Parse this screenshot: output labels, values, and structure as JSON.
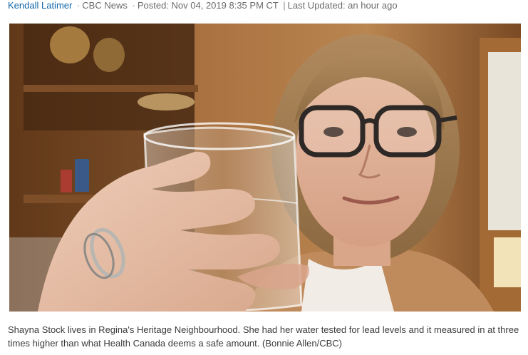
{
  "byline": {
    "author": "Kendall Latimer",
    "bullet": "·",
    "outlet": "CBC News",
    "posted": "Posted: Nov 04, 2019 8:35 PM CT",
    "divider": "|",
    "updated": "Last Updated: an hour ago"
  },
  "photo": {
    "subject": "woman-holding-water-glass"
  },
  "caption": {
    "text": "Shayna Stock lives in Regina's Heritage Neighbourhood. She had her water tested for lead levels and it measured in at three times higher than what Health Canada deems a safe amount. (Bonnie Allen/CBC)"
  },
  "colors": {
    "link": "#0f64a8",
    "meta": "#6b6b6b",
    "caption": "#3b3b3b"
  }
}
